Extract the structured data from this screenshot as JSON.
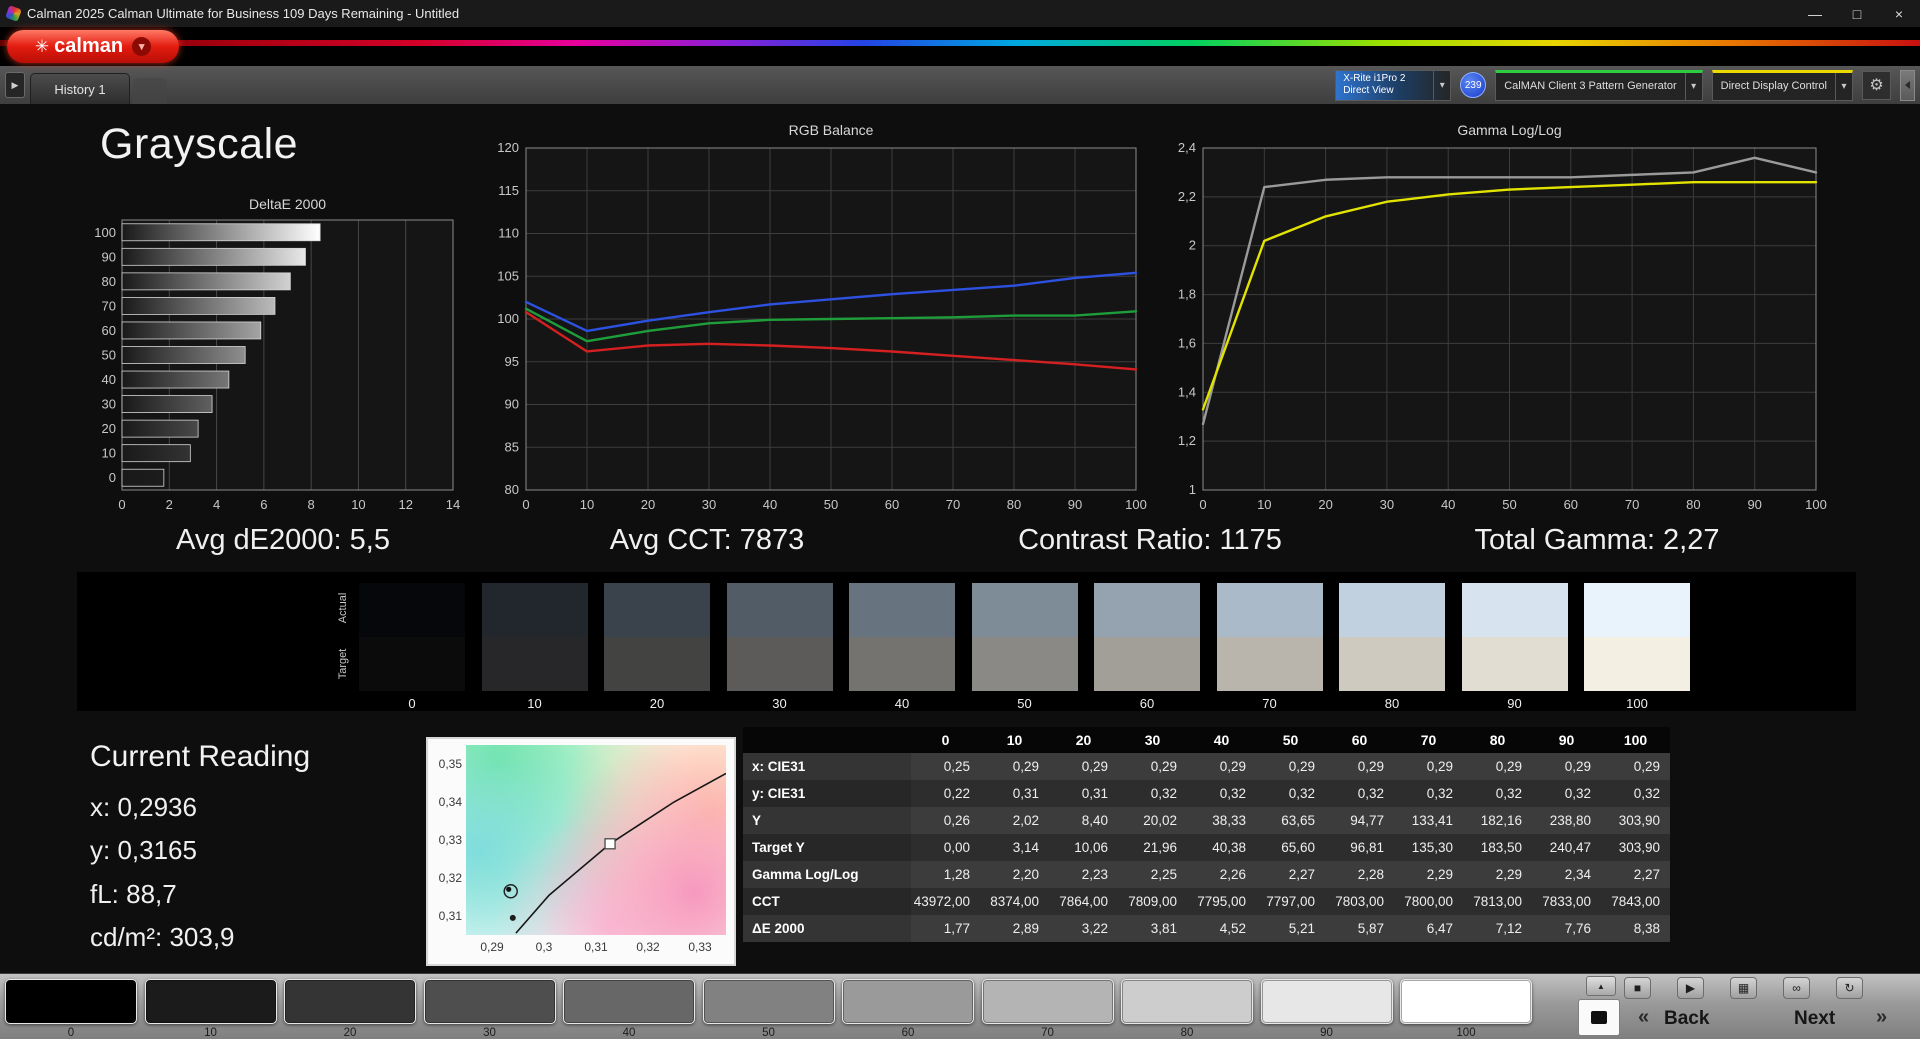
{
  "window": {
    "title": "Calman 2025 Calman Ultimate for Business 109 Days Remaining  - Untitled",
    "minimize": "—",
    "maximize": "□",
    "close": "×"
  },
  "brand": {
    "logo_icon": "✳",
    "logo_text": "calman"
  },
  "icons": {
    "caret_down": "▾",
    "gear": "⚙",
    "panel_arrow": "▶",
    "up_arrow": "▲"
  },
  "tab_bar": {
    "tabs": [
      {
        "label": "History 1"
      }
    ],
    "meter_line1": "X-Rite i1Pro 2",
    "meter_line2": "Direct View",
    "badge": "239",
    "pattern_generator": "CalMAN Client 3 Pattern Generator",
    "display_control": "Direct Display Control"
  },
  "page_title": "Grayscale",
  "stats": [
    {
      "label": "Avg dE2000: 5,5"
    },
    {
      "label": "Avg CCT: 7873"
    },
    {
      "label": "Contrast Ratio: 1175"
    },
    {
      "label": "Total Gamma: 2,27"
    }
  ],
  "chart_data": [
    {
      "type": "bar",
      "title": "DeltaE 2000",
      "orientation": "horizontal",
      "categories": [
        "0",
        "10",
        "20",
        "30",
        "40",
        "50",
        "60",
        "70",
        "80",
        "90",
        "100"
      ],
      "values": [
        1.77,
        2.89,
        3.22,
        3.81,
        4.52,
        5.21,
        5.87,
        6.47,
        7.12,
        7.76,
        8.38
      ],
      "xlim": [
        0,
        14
      ],
      "x_ticks": [
        0,
        2,
        4,
        6,
        8,
        10,
        12,
        14
      ],
      "order_note": "level 100 drawn at top, level 0 at bottom"
    },
    {
      "type": "line",
      "title": "RGB Balance",
      "x": [
        0,
        10,
        20,
        30,
        40,
        50,
        60,
        70,
        80,
        90,
        100
      ],
      "ylim": [
        80,
        120
      ],
      "y_ticks": [
        80,
        85,
        90,
        95,
        100,
        105,
        110,
        115,
        120
      ],
      "series": [
        {
          "name": "Blue",
          "color": "#2d51e0",
          "values": [
            102.0,
            98.6,
            99.8,
            100.8,
            101.7,
            102.3,
            102.9,
            103.4,
            103.9,
            104.8,
            105.4
          ]
        },
        {
          "name": "Green",
          "color": "#1f9d3a",
          "values": [
            101.2,
            97.4,
            98.6,
            99.5,
            99.9,
            100.0,
            100.1,
            100.2,
            100.4,
            100.4,
            100.9
          ]
        },
        {
          "name": "Red",
          "color": "#d42020",
          "values": [
            100.8,
            96.2,
            96.9,
            97.1,
            96.9,
            96.6,
            96.2,
            95.7,
            95.2,
            94.7,
            94.1
          ]
        }
      ]
    },
    {
      "type": "line",
      "title": "Gamma Log/Log",
      "x": [
        0,
        10,
        20,
        30,
        40,
        50,
        60,
        70,
        80,
        90,
        100
      ],
      "ylim": [
        1,
        2.4
      ],
      "y_ticks": [
        1,
        1.2,
        1.4,
        1.6,
        1.8,
        2,
        2.2,
        2.4
      ],
      "y_tick_labels": [
        "1",
        "1,2",
        "1,4",
        "1,6",
        "1,8",
        "2",
        "2,2",
        "2,4"
      ],
      "series": [
        {
          "name": "Measured",
          "color": "#9a9a9a",
          "values": [
            1.27,
            2.24,
            2.27,
            2.28,
            2.28,
            2.28,
            2.28,
            2.29,
            2.3,
            2.36,
            2.3
          ]
        },
        {
          "name": "Gamma",
          "color": "#e3e300",
          "values": [
            1.33,
            2.02,
            2.12,
            2.18,
            2.21,
            2.23,
            2.24,
            2.25,
            2.26,
            2.26,
            2.26
          ]
        }
      ]
    }
  ],
  "swatches": {
    "actual_label": "Actual",
    "target_label": "Target",
    "cells": [
      {
        "level": "0",
        "actual": "#06070b",
        "target": "#0b0b0b"
      },
      {
        "level": "10",
        "actual": "#22272d",
        "target": "#27272a"
      },
      {
        "level": "20",
        "actual": "#3a424b",
        "target": "#434342"
      },
      {
        "level": "30",
        "actual": "#515c66",
        "target": "#5c5b59"
      },
      {
        "level": "40",
        "actual": "#677480",
        "target": "#747370"
      },
      {
        "level": "50",
        "actual": "#7e8c98",
        "target": "#8b8985"
      },
      {
        "level": "60",
        "actual": "#95a3b0",
        "target": "#a29f99"
      },
      {
        "level": "70",
        "actual": "#abbac8",
        "target": "#b9b5ad"
      },
      {
        "level": "80",
        "actual": "#c2d1df",
        "target": "#cfcac0"
      },
      {
        "level": "90",
        "actual": "#d7e4ef",
        "target": "#e2ddd2"
      },
      {
        "level": "100",
        "actual": "#e9f3fb",
        "target": "#f4efe3"
      }
    ]
  },
  "current_reading": {
    "title": "Current Reading",
    "lines": [
      "x: 0,2936",
      "y: 0,3165",
      "fL: 88,7",
      "cd/m²: 303,9"
    ]
  },
  "cie": {
    "x_range": [
      0.285,
      0.335
    ],
    "y_range": [
      0.305,
      0.355
    ],
    "x_ticks": [
      {
        "value": 0.29,
        "label": "0,29"
      },
      {
        "value": 0.3,
        "label": "0,3"
      },
      {
        "value": 0.31,
        "label": "0,31"
      },
      {
        "value": 0.32,
        "label": "0,32"
      },
      {
        "value": 0.33,
        "label": "0,33"
      }
    ],
    "y_ticks": [
      {
        "value": 0.35,
        "label": "0,35"
      },
      {
        "value": 0.34,
        "label": "0,34"
      },
      {
        "value": 0.33,
        "label": "0,33"
      },
      {
        "value": 0.32,
        "label": "0,32"
      },
      {
        "value": 0.31,
        "label": "0,31"
      }
    ],
    "locus_curve": [
      [
        0.2946,
        0.3055
      ],
      [
        0.301,
        0.3155
      ],
      [
        0.3127,
        0.329
      ],
      [
        0.325,
        0.34
      ],
      [
        0.335,
        0.3475
      ]
    ],
    "target_point": [
      0.3127,
      0.329
    ],
    "measured_point": [
      0.2936,
      0.3165
    ],
    "black_point": [
      0.294,
      0.3095
    ]
  },
  "table": {
    "columns": [
      "0",
      "10",
      "20",
      "30",
      "40",
      "50",
      "60",
      "70",
      "80",
      "90",
      "100"
    ],
    "rows": [
      {
        "label": "x: CIE31",
        "values": [
          "0,25",
          "0,29",
          "0,29",
          "0,29",
          "0,29",
          "0,29",
          "0,29",
          "0,29",
          "0,29",
          "0,29",
          "0,29"
        ]
      },
      {
        "label": "y: CIE31",
        "values": [
          "0,22",
          "0,31",
          "0,31",
          "0,32",
          "0,32",
          "0,32",
          "0,32",
          "0,32",
          "0,32",
          "0,32",
          "0,32"
        ]
      },
      {
        "label": "Y",
        "values": [
          "0,26",
          "2,02",
          "8,40",
          "20,02",
          "38,33",
          "63,65",
          "94,77",
          "133,41",
          "182,16",
          "238,80",
          "303,90"
        ]
      },
      {
        "label": "Target Y",
        "values": [
          "0,00",
          "3,14",
          "10,06",
          "21,96",
          "40,38",
          "65,60",
          "96,81",
          "135,30",
          "183,50",
          "240,47",
          "303,90"
        ]
      },
      {
        "label": "Gamma Log/Log",
        "values": [
          "1,28",
          "2,20",
          "2,23",
          "2,25",
          "2,26",
          "2,27",
          "2,28",
          "2,29",
          "2,29",
          "2,34",
          "2,27"
        ]
      },
      {
        "label": "CCT",
        "values": [
          "43972,00",
          "8374,00",
          "7864,00",
          "7809,00",
          "7795,00",
          "7797,00",
          "7803,00",
          "7800,00",
          "7813,00",
          "7833,00",
          "7843,00"
        ]
      },
      {
        "label": "ΔE 2000",
        "values": [
          "1,77",
          "2,89",
          "3,22",
          "3,81",
          "4,52",
          "5,21",
          "5,87",
          "6,47",
          "7,12",
          "7,76",
          "8,38"
        ]
      }
    ]
  },
  "bottom_bar": {
    "patches": [
      {
        "level": "0",
        "color": "#000000"
      },
      {
        "level": "10",
        "color": "#1b1b1b"
      },
      {
        "level": "20",
        "color": "#343434"
      },
      {
        "level": "30",
        "color": "#4e4e4e"
      },
      {
        "level": "40",
        "color": "#676767"
      },
      {
        "level": "50",
        "color": "#818181"
      },
      {
        "level": "60",
        "color": "#9a9a9a"
      },
      {
        "level": "70",
        "color": "#b4b4b4"
      },
      {
        "level": "80",
        "color": "#cdcdcd"
      },
      {
        "level": "90",
        "color": "#e7e7e7"
      },
      {
        "level": "100",
        "color": "#ffffff"
      }
    ],
    "transport": [
      {
        "name": "stop-button",
        "glyph": "■"
      },
      {
        "name": "play-button",
        "glyph": "▶"
      },
      {
        "name": "save-button",
        "glyph": "▦"
      },
      {
        "name": "link-button",
        "glyph": "∞"
      },
      {
        "name": "refresh-button",
        "glyph": "↻"
      }
    ],
    "back_chevron": "«",
    "back_label": "Back",
    "next_label": "Next",
    "next_chevron": "»"
  }
}
